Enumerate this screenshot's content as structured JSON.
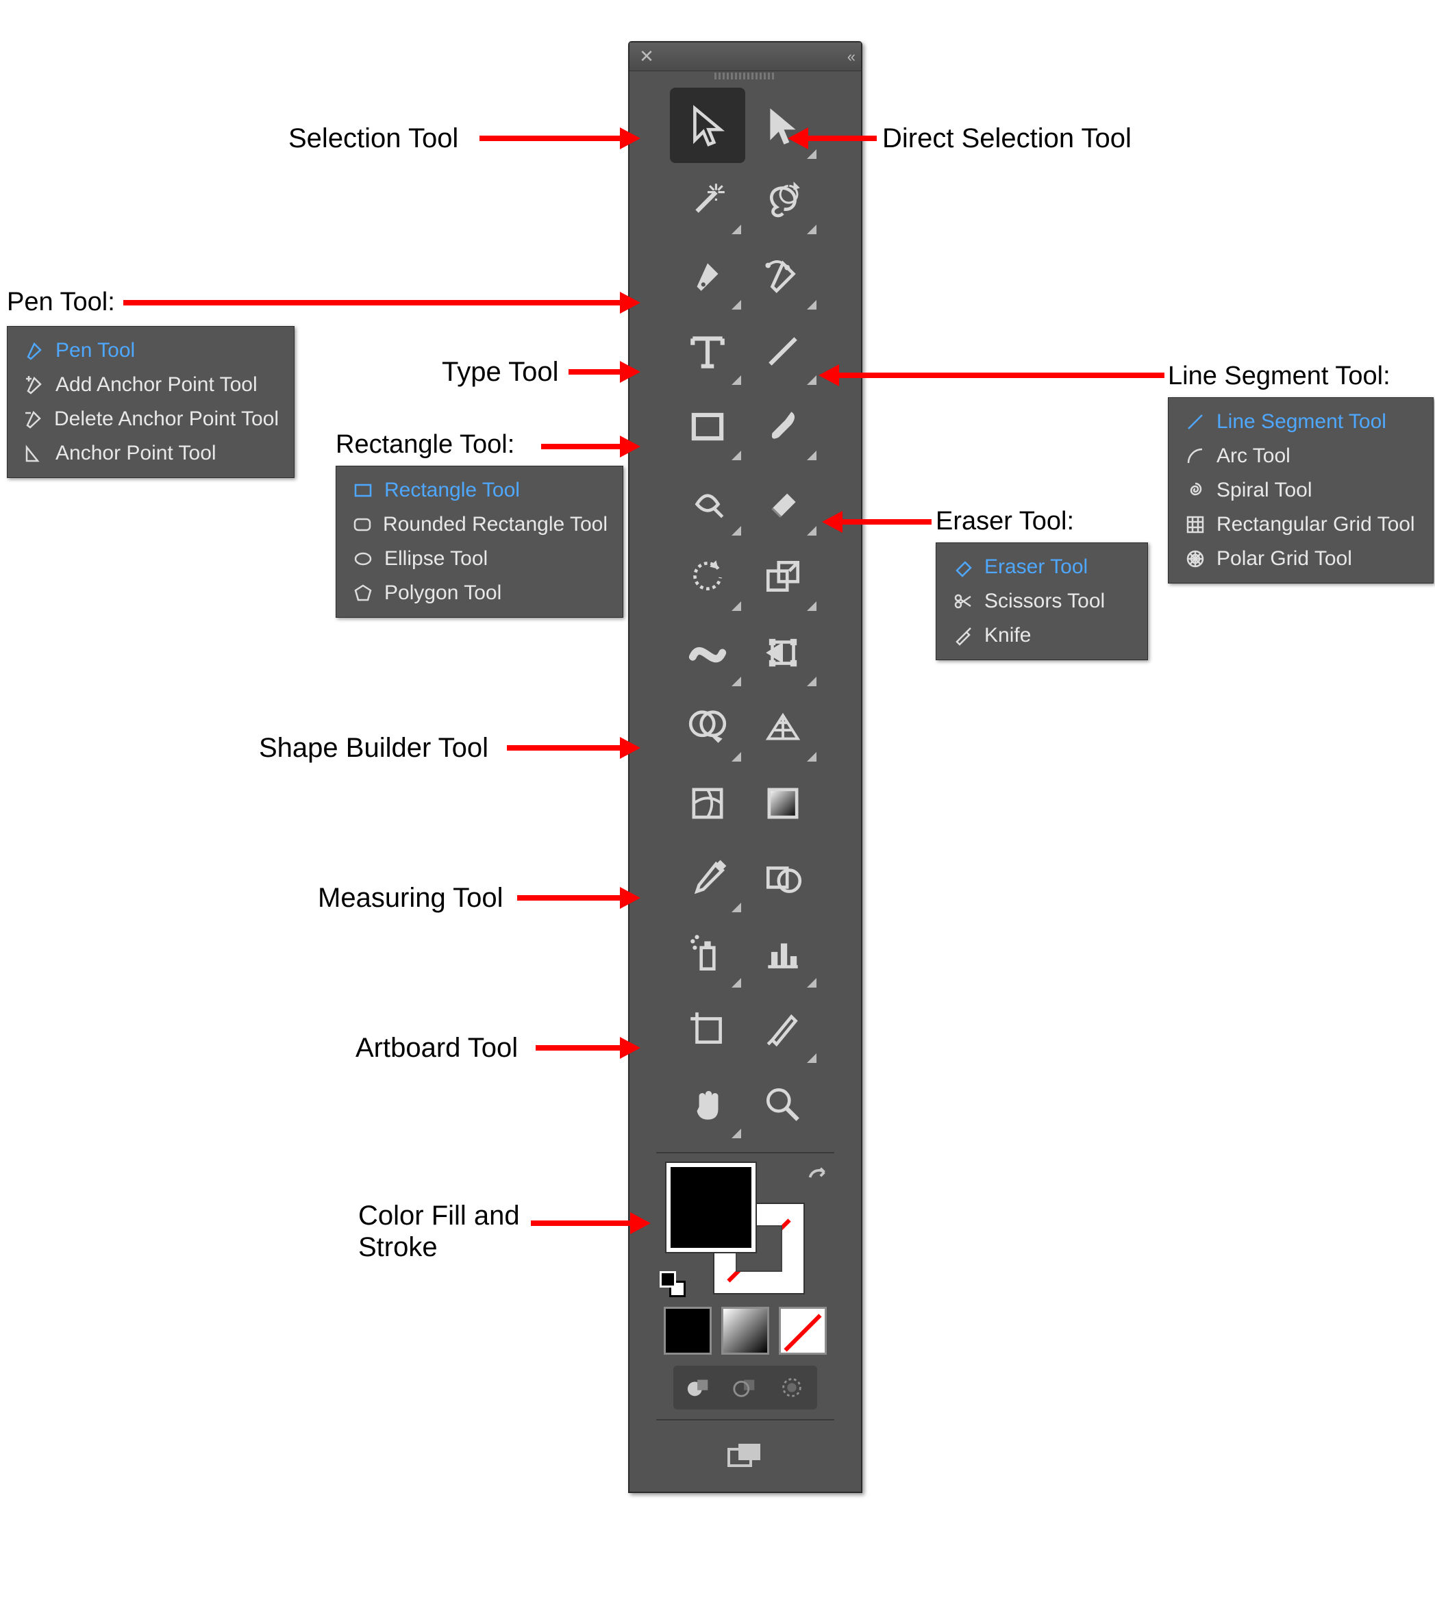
{
  "callouts": {
    "selection": "Selection Tool",
    "direct_selection": "Direct Selection Tool",
    "pen": "Pen Tool:",
    "type": "Type Tool",
    "rectangle": "Rectangle Tool:",
    "line_segment": "Line Segment Tool:",
    "eraser": "Eraser Tool:",
    "shape_builder": "Shape Builder Tool",
    "measuring": "Measuring Tool",
    "artboard": "Artboard Tool",
    "fill_stroke_1": "Color Fill and",
    "fill_stroke_2": "Stroke"
  },
  "flyouts": {
    "pen": [
      {
        "label": "Pen Tool",
        "icon": "pen",
        "active": true
      },
      {
        "label": "Add Anchor Point Tool",
        "icon": "add-anchor",
        "active": false
      },
      {
        "label": "Delete Anchor Point Tool",
        "icon": "del-anchor",
        "active": false
      },
      {
        "label": "Anchor Point Tool",
        "icon": "anchor",
        "active": false
      }
    ],
    "rectangle": [
      {
        "label": "Rectangle Tool",
        "icon": "rect",
        "active": true
      },
      {
        "label": "Rounded Rectangle Tool",
        "icon": "roundrect",
        "active": false
      },
      {
        "label": "Ellipse Tool",
        "icon": "ellipse",
        "active": false
      },
      {
        "label": "Polygon Tool",
        "icon": "polygon",
        "active": false
      }
    ],
    "line": [
      {
        "label": "Line Segment Tool",
        "icon": "line",
        "active": true
      },
      {
        "label": "Arc Tool",
        "icon": "arc",
        "active": false
      },
      {
        "label": "Spiral Tool",
        "icon": "spiral",
        "active": false
      },
      {
        "label": "Rectangular Grid Tool",
        "icon": "rectgrid",
        "active": false
      },
      {
        "label": "Polar Grid Tool",
        "icon": "polargrid",
        "active": false
      }
    ],
    "eraser": [
      {
        "label": "Eraser Tool",
        "icon": "eraser",
        "active": true
      },
      {
        "label": "Scissors Tool",
        "icon": "scissors",
        "active": false
      },
      {
        "label": "Knife",
        "icon": "knife",
        "active": false
      }
    ]
  },
  "tools": [
    {
      "name": "selection",
      "corner": false,
      "selected": true
    },
    {
      "name": "direct-selection",
      "corner": true,
      "selected": false
    },
    {
      "name": "magic-wand",
      "corner": true,
      "selected": false
    },
    {
      "name": "lasso",
      "corner": true,
      "selected": false
    },
    {
      "name": "pen",
      "corner": true,
      "selected": false
    },
    {
      "name": "curvature",
      "corner": true,
      "selected": false
    },
    {
      "name": "type",
      "corner": true,
      "selected": false
    },
    {
      "name": "line-segment",
      "corner": true,
      "selected": false
    },
    {
      "name": "rectangle",
      "corner": true,
      "selected": false
    },
    {
      "name": "paintbrush",
      "corner": true,
      "selected": false
    },
    {
      "name": "shaper",
      "corner": true,
      "selected": false
    },
    {
      "name": "eraser",
      "corner": true,
      "selected": false
    },
    {
      "name": "rotate",
      "corner": true,
      "selected": false
    },
    {
      "name": "scale",
      "corner": true,
      "selected": false
    },
    {
      "name": "width",
      "corner": true,
      "selected": false
    },
    {
      "name": "free-transform",
      "corner": true,
      "selected": false
    },
    {
      "name": "shape-builder",
      "corner": true,
      "selected": false
    },
    {
      "name": "perspective-grid",
      "corner": true,
      "selected": false
    },
    {
      "name": "mesh",
      "corner": false,
      "selected": false
    },
    {
      "name": "gradient",
      "corner": false,
      "selected": false
    },
    {
      "name": "eyedropper",
      "corner": true,
      "selected": false
    },
    {
      "name": "blend",
      "corner": false,
      "selected": false
    },
    {
      "name": "symbol-sprayer",
      "corner": true,
      "selected": false
    },
    {
      "name": "column-graph",
      "corner": true,
      "selected": false
    },
    {
      "name": "artboard",
      "corner": false,
      "selected": false
    },
    {
      "name": "slice",
      "corner": true,
      "selected": false
    },
    {
      "name": "hand",
      "corner": true,
      "selected": false
    },
    {
      "name": "zoom",
      "corner": false,
      "selected": false
    }
  ],
  "color_modes": [
    "color",
    "gradient",
    "none"
  ],
  "draw_modes": [
    "normal",
    "behind",
    "inside"
  ]
}
